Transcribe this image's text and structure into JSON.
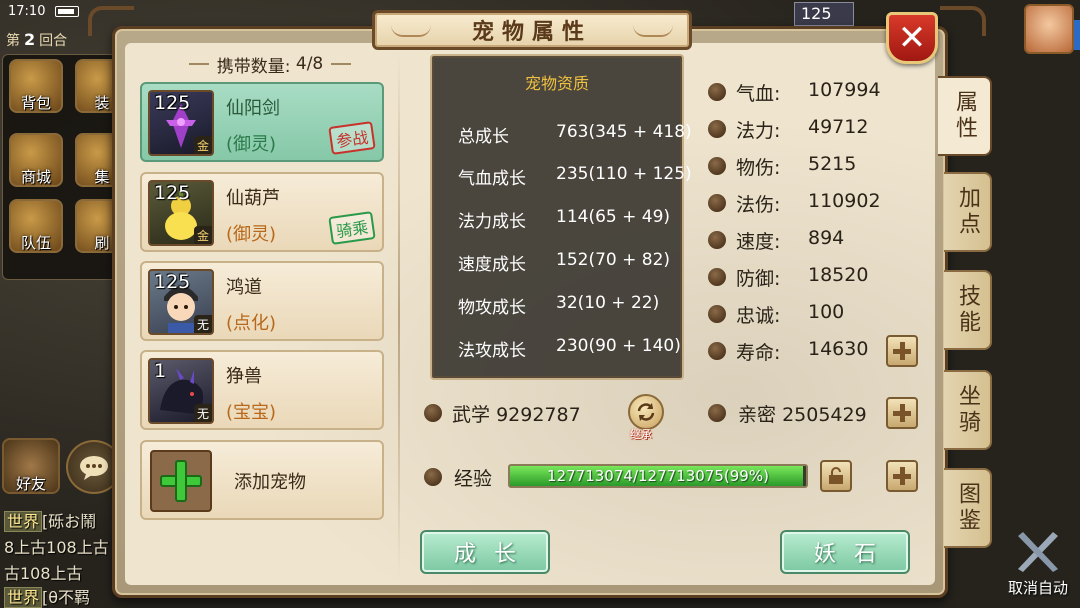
{
  "status": {
    "time": "17:10"
  },
  "round": {
    "prefix": "第",
    "number": "2",
    "suffix": "回合"
  },
  "left_menu": [
    {
      "label": "背包"
    },
    {
      "label": "装"
    },
    {
      "label": "商城"
    },
    {
      "label": "集"
    },
    {
      "label": "队伍"
    },
    {
      "label": "刷"
    }
  ],
  "friends": {
    "label": "好友"
  },
  "chat": [
    {
      "tag": "世界",
      "text": "[砾お鬧"
    },
    {
      "tag": "",
      "text": "8上古108上古"
    },
    {
      "tag": "",
      "text": "古108上古"
    },
    {
      "tag": "世界",
      "text": "[θ不羁"
    }
  ],
  "top_right": {
    "level": "125"
  },
  "auto_button": {
    "label": "取消自动"
  },
  "dialog": {
    "title": "宠物属性",
    "close": "✕"
  },
  "side_tabs": [
    {
      "label": "属性",
      "active": true
    },
    {
      "label": "加点"
    },
    {
      "label": "技能"
    },
    {
      "label": "坐骑"
    },
    {
      "label": "图鉴"
    }
  ],
  "carry": {
    "label": "携带数量:",
    "value": "4/8"
  },
  "pets": [
    {
      "level": "125",
      "name": "仙阳剑",
      "type": "(御灵)",
      "grade": "金",
      "stamp": "参战",
      "stamp_color": "red",
      "selected": true
    },
    {
      "level": "125",
      "name": "仙葫芦",
      "type": "(御灵)",
      "grade": "金",
      "stamp": "骑乘",
      "stamp_color": "green"
    },
    {
      "level": "125",
      "name": "鸿道",
      "type": "(点化)",
      "grade": "无",
      "stamp": ""
    },
    {
      "level": "1",
      "name": "狰兽",
      "type": "(宝宝)",
      "grade": "无",
      "stamp": ""
    }
  ],
  "add_pet": {
    "label": "添加宠物"
  },
  "aptitude": {
    "title": "宠物资质",
    "rows": [
      {
        "label": "总成长",
        "value": "763(345 + 418)"
      },
      {
        "label": "气血成长",
        "value": "235(110 + 125)"
      },
      {
        "label": "法力成长",
        "value": "114(65 + 49)"
      },
      {
        "label": "速度成长",
        "value": "152(70 + 82)"
      },
      {
        "label": "物攻成长",
        "value": "32(10 + 22)"
      },
      {
        "label": "法攻成长",
        "value": "230(90 + 140)"
      }
    ]
  },
  "stats": [
    {
      "label": "气血:",
      "value": "107994",
      "icon": "heart-icon"
    },
    {
      "label": "法力:",
      "value": "49712",
      "icon": "mana-drop-icon"
    },
    {
      "label": "物伤:",
      "value": "5215",
      "icon": "sword-icon"
    },
    {
      "label": "法伤:",
      "value": "110902",
      "icon": "flame-icon"
    },
    {
      "label": "速度:",
      "value": "894",
      "icon": "lightning-icon"
    },
    {
      "label": "防御:",
      "value": "18520",
      "icon": "shield-icon"
    },
    {
      "label": "忠诚:",
      "value": "100",
      "icon": "handshake-icon"
    },
    {
      "label": "寿命:",
      "value": "14630",
      "icon": "hourglass-icon"
    }
  ],
  "martial": {
    "label": "武学",
    "value": "9292787"
  },
  "inherit": {
    "label": "继承"
  },
  "intimacy": {
    "label": "亲密",
    "value": "2505429"
  },
  "exp": {
    "label": "经验",
    "text": "127713074/127713075(99%)",
    "percent": 99
  },
  "buttons": {
    "grow": "成长",
    "demon_stone": "妖石"
  },
  "colors": {
    "accent_green": "#7cc8a2",
    "title_gold": "#f0c040",
    "close_red": "#d83a2a"
  }
}
